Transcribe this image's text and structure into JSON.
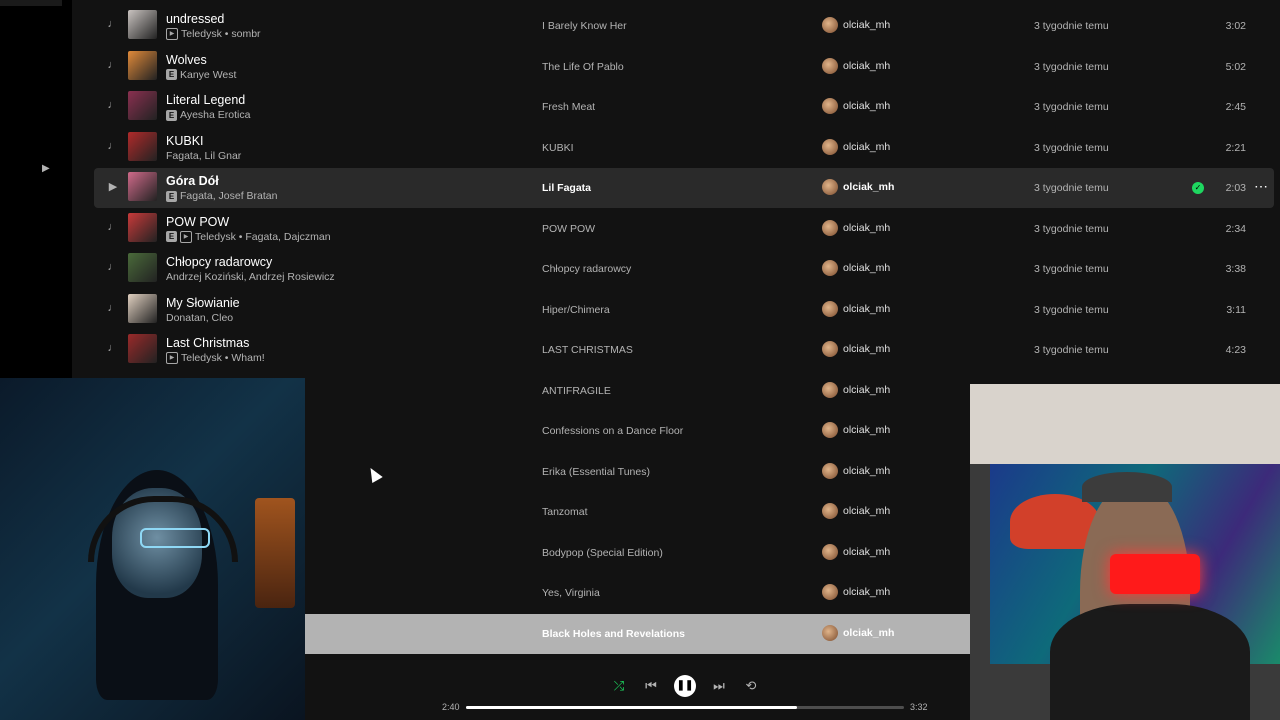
{
  "tracks": [
    {
      "index": "♩",
      "title": "undressed",
      "badges": [
        "video"
      ],
      "artist": "Teledysk • sombr",
      "album": "I Barely Know Her",
      "user": "olciak_mh",
      "date": "3 tygodnie temu",
      "duration": "3:02",
      "cover": "#c9c3c0"
    },
    {
      "index": "♩",
      "title": "Wolves",
      "badges": [
        "E"
      ],
      "artist": "Kanye West",
      "album": "The Life Of Pablo",
      "user": "olciak_mh",
      "date": "3 tygodnie temu",
      "duration": "5:02",
      "cover": "#e08a3a"
    },
    {
      "index": "♩",
      "title": "Literal Legend",
      "badges": [
        "E"
      ],
      "artist": "Ayesha Erotica",
      "album": "Fresh Meat",
      "user": "olciak_mh",
      "date": "3 tygodnie temu",
      "duration": "2:45",
      "cover": "#8a3050"
    },
    {
      "index": "♩",
      "title": "KUBKI",
      "badges": [],
      "artist": "Fagata, Lil Gnar",
      "album": "KUBKI",
      "user": "olciak_mh",
      "date": "3 tygodnie temu",
      "duration": "2:21",
      "cover": "#b02a2a"
    },
    {
      "index": "▶",
      "title": "Góra Dół",
      "badges": [
        "E"
      ],
      "artist": "Fagata, Josef Bratan",
      "album": "Lil Fagata",
      "user": "olciak_mh",
      "date": "3 tygodnie temu",
      "duration": "2:03",
      "cover": "#d06a8a",
      "hover": true
    },
    {
      "index": "♩",
      "title": "POW POW",
      "badges": [
        "E",
        "video"
      ],
      "artist": "Teledysk • Fagata, Dajczman",
      "album": "POW POW",
      "user": "olciak_mh",
      "date": "3 tygodnie temu",
      "duration": "2:34",
      "cover": "#c83a3a"
    },
    {
      "index": "♩",
      "title": "Chłopcy radarowcy",
      "badges": [],
      "artist": "Andrzej Koziński, Andrzej Rosiewicz",
      "album": "Chłopcy radarowcy",
      "user": "olciak_mh",
      "date": "3 tygodnie temu",
      "duration": "3:38",
      "cover": "#4a6a3a"
    },
    {
      "index": "♩",
      "title": "My Słowianie",
      "badges": [],
      "artist": "Donatan, Cleo",
      "album": "Hiper/Chimera",
      "user": "olciak_mh",
      "date": "3 tygodnie temu",
      "duration": "3:11",
      "cover": "#e0d0c0"
    },
    {
      "index": "♩",
      "title": "Last Christmas",
      "badges": [
        "video"
      ],
      "artist": "Teledysk • Wham!",
      "album": "LAST CHRISTMAS",
      "user": "olciak_mh",
      "date": "3 tygodnie temu",
      "duration": "4:23",
      "cover": "#9a2a2a"
    },
    {
      "index": "",
      "title": "",
      "badges": [],
      "artist": "",
      "album": "ANTIFRAGILE",
      "user": "olciak_mh",
      "date": "",
      "duration": "",
      "cover": ""
    },
    {
      "index": "",
      "title": "",
      "badges": [],
      "artist": "",
      "album": "Confessions on a Dance Floor",
      "user": "olciak_mh",
      "date": "",
      "duration": "",
      "cover": ""
    },
    {
      "index": "",
      "title": "",
      "badges": [],
      "artist": "",
      "album": "Erika (Essential Tunes)",
      "user": "olciak_mh",
      "date": "",
      "duration": "",
      "cover": ""
    },
    {
      "index": "",
      "title": "",
      "badges": [],
      "artist": "",
      "album": "Tanzomat",
      "user": "olciak_mh",
      "date": "",
      "duration": "",
      "cover": ""
    },
    {
      "index": "",
      "title": "",
      "badges": [],
      "artist": "",
      "album": "Bodypop (Special Edition)",
      "user": "olciak_mh",
      "date": "",
      "duration": "",
      "cover": ""
    },
    {
      "index": "",
      "title": "",
      "badges": [],
      "artist": "",
      "album": "Yes, Virginia",
      "user": "olciak_mh",
      "date": "",
      "duration": "",
      "cover": ""
    },
    {
      "index": "",
      "title": "",
      "badges": [],
      "artist": "",
      "album": "Black Holes and Revelations",
      "user": "olciak_mh",
      "date": "",
      "duration": "",
      "cover": "",
      "playing": true
    }
  ],
  "badge_labels": {
    "explicit": "E",
    "video": "▶"
  },
  "icons": {
    "more": "more-options-icon",
    "check": "check-circle-icon"
  },
  "player": {
    "elapsed": "2:40",
    "total": "3:32",
    "progress": 0.755,
    "shuffle_active": true,
    "accent": "#1ed760"
  }
}
